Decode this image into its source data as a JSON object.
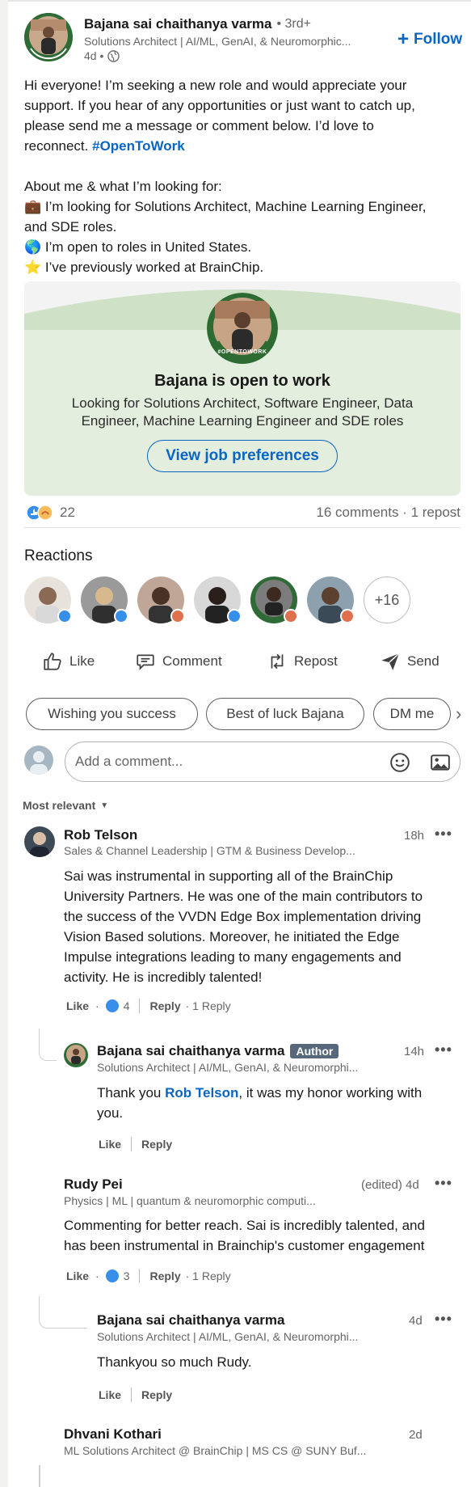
{
  "post": {
    "author": "Bajana sai chaithanya varma",
    "degree": "• 3rd+",
    "headline": "Solutions Architect | AI/ML, GenAI, & Neuromorphic...",
    "time": "4d •",
    "follow_label": "Follow",
    "body_lines": [
      "Hi everyone! I’m seeking a new role and would appreciate your",
      "support. If you hear of any opportunities or just want to catch up,",
      "please send me a message or comment below. I’d love to"
    ],
    "body_last": "reconnect.",
    "hashtag": "#OpenToWork",
    "about_title": "About me & what I’m looking for:",
    "about_line1a": "I’m looking for Solutions Architect, Machine Learning Engineer,",
    "about_line1b": "and SDE roles.",
    "about_line2": "I’m open to roles in United States.",
    "about_line3": "I’ve previously worked at BrainChip.",
    "emoji_briefcase": "💼",
    "emoji_globe": "🌎",
    "emoji_star": "⭐"
  },
  "otw_card": {
    "badge_text": "#OPENTOWORK",
    "title": "Bajana is open to work",
    "desc_line1": "Looking for Solutions Architect, Software Engineer, Data",
    "desc_line2": "Engineer, Machine Learning Engineer and SDE roles",
    "button_label": "View job preferences"
  },
  "social": {
    "reaction_count": "22",
    "comments_reposts": "16 comments · 1 repost"
  },
  "reactions": {
    "title": "Reactions",
    "more_count": "+16"
  },
  "actions": {
    "like": "Like",
    "comment": "Comment",
    "repost": "Repost",
    "send": "Send"
  },
  "suggestions": [
    "Wishing you success",
    "Best of luck Bajana",
    "DM me"
  ],
  "composer": {
    "placeholder": "Add a comment..."
  },
  "sort": {
    "label": "Most relevant"
  },
  "comments": [
    {
      "name": "Rob Telson",
      "headline": "Sales & Channel Leadership | GTM & Business Develop...",
      "time": "18h",
      "body": [
        "Sai was instrumental in supporting all of the BrainChip",
        "University Partners. He was one of the main contributors to",
        "the success of the VVDN Edge Box implementation driving",
        "Vision Based solutions. Moreover, he initiated the Edge",
        "Impulse integrations leading to many engagements and",
        "activity. He is incredibly talented!"
      ],
      "like": "Like",
      "like_count": "4",
      "reply": "Reply",
      "replies": "· 1 Reply"
    },
    {
      "name": "Rudy Pei",
      "headline": "Physics | ML | quantum & neuromorphic computi...",
      "time": "(edited) 4d",
      "body": [
        "Commenting for better reach. Sai is incredibly talented, and",
        "has been instrumental in Brainchip's customer engagement"
      ],
      "like": "Like",
      "like_count": "3",
      "reply": "Reply",
      "replies": "· 1 Reply"
    },
    {
      "name": "Dhvani Kothari",
      "headline": "ML Solutions Architect @ BrainChip | MS CS @ SUNY Buf...",
      "time": "2d"
    }
  ],
  "replies": [
    {
      "name": "Bajana sai chaithanya varma",
      "author_badge": "Author",
      "headline": "Solutions Architect | AI/ML, GenAI, & Neuromorphi...",
      "time": "14h",
      "body_prefix": "Thank you ",
      "mention": "Rob Telson",
      "body_suffix": ", it was my honor working with",
      "body_line2": "you.",
      "like": "Like",
      "reply": "Reply"
    },
    {
      "name": "Bajana sai chaithanya varma",
      "headline": "Solutions Architect | AI/ML, GenAI, & Neuromorphi...",
      "time": "4d",
      "body": "Thankyou so much Rudy.",
      "like": "Like",
      "reply": "Reply"
    }
  ],
  "colors": {
    "link_blue": "#0a66c2",
    "otw_green": "#e3eedf",
    "otw_ring": "#2d6b33"
  }
}
